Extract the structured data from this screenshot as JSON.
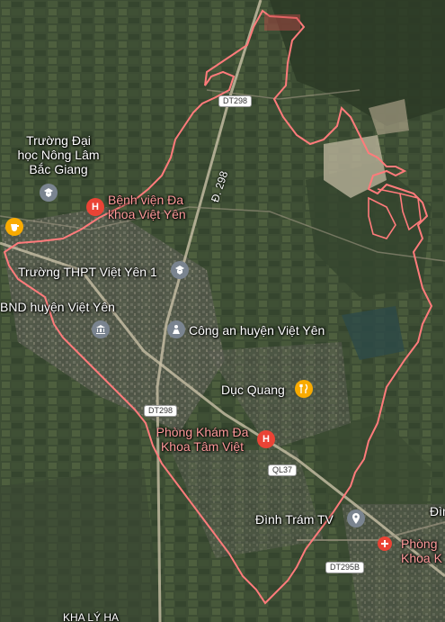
{
  "map": {
    "places": {
      "truong_dai_hoc": [
        "Trường Đại",
        "học Nông Lâm",
        "Bắc Giang"
      ],
      "benh_vien": [
        "Bệnh viện Đa",
        "khoa Việt Yên"
      ],
      "thpt": "Trường THPT Việt Yên 1",
      "ubnd": "BND huyện Việt Yên",
      "cong_an": "Công an huyện Việt Yên",
      "duc_quang": "Dục Quang",
      "phong_kham_tam_viet": [
        "Phòng Khám Đa",
        "Khoa Tâm Việt"
      ],
      "dinh_tram_tv": "Đình Trám TV",
      "phong_kham_right": [
        "Phòng",
        "Khoa K"
      ],
      "kha_ly_ha": "KHA LÝ HẠ",
      "right_edge": "Đình"
    },
    "roads": {
      "dt298_top": "DT298",
      "dt298_left": "DT298",
      "ql37": "QL37",
      "dt295b": "DT295B",
      "d298": "Đ. 298"
    },
    "icons": {
      "hospital": "H",
      "school": "school-icon",
      "government": "government-icon",
      "police": "police-icon",
      "restaurant": "restaurant-icon",
      "poi": "place-pin-icon",
      "cafe": "cafe-icon"
    },
    "colors": {
      "boundary": "#ff6b6b",
      "hospital_pin": "#ea4335",
      "restaurant_pin": "#f9ab00",
      "gray_pin": "#7a8490"
    }
  }
}
